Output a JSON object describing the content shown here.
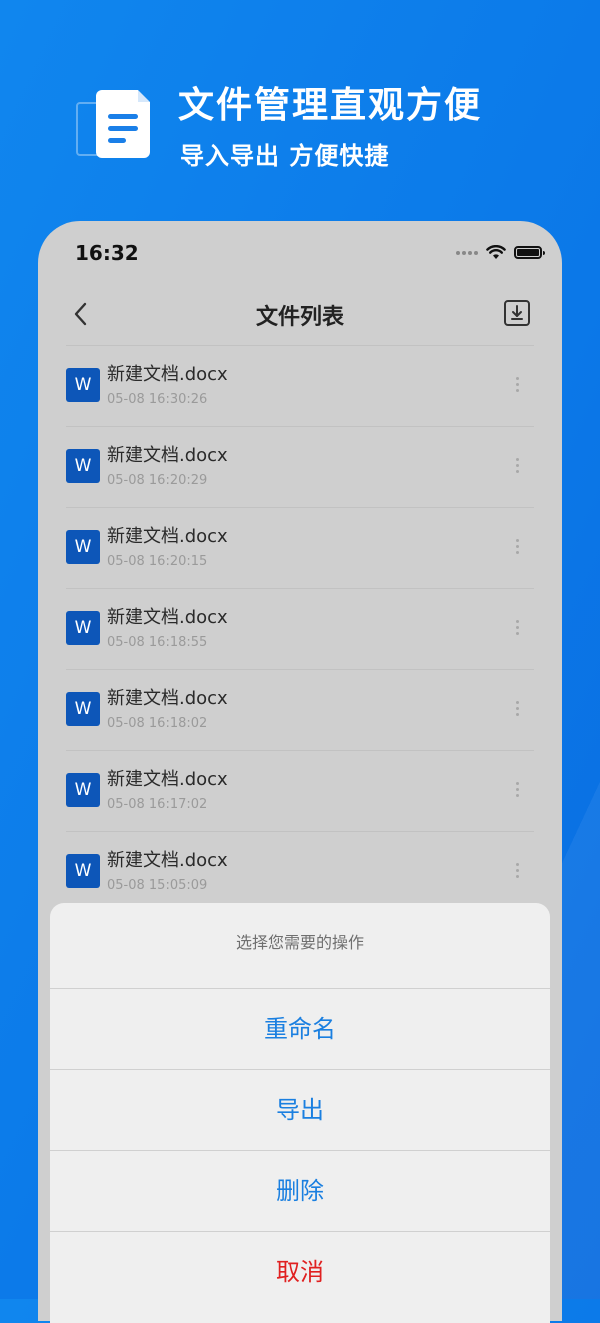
{
  "promo": {
    "title": "文件管理直观方便",
    "subtitle": "导入导出 方便快捷",
    "icon": "document-icon"
  },
  "status_bar": {
    "time": "16:32"
  },
  "nav": {
    "title": "文件列表",
    "back_icon": "chevron-left-icon",
    "action_icon": "download-tray-icon"
  },
  "files": [
    {
      "icon_letter": "W",
      "name": "新建文档.docx",
      "time": "05-08 16:30:26"
    },
    {
      "icon_letter": "W",
      "name": "新建文档.docx",
      "time": "05-08 16:20:29"
    },
    {
      "icon_letter": "W",
      "name": "新建文档.docx",
      "time": "05-08 16:20:15"
    },
    {
      "icon_letter": "W",
      "name": "新建文档.docx",
      "time": "05-08 16:18:55"
    },
    {
      "icon_letter": "W",
      "name": "新建文档.docx",
      "time": "05-08 16:18:02"
    },
    {
      "icon_letter": "W",
      "name": "新建文档.docx",
      "time": "05-08 16:17:02"
    },
    {
      "icon_letter": "W",
      "name": "新建文档.docx",
      "time": "05-08 15:05:09"
    }
  ],
  "action_sheet": {
    "prompt": "选择您需要的操作",
    "rename": "重命名",
    "export": "导出",
    "delete": "删除",
    "cancel": "取消"
  },
  "colors": {
    "brand_blue": "#0b78e8",
    "action_blue": "#1a7fe0",
    "cancel_red": "#e02020",
    "word_icon": "#0d56b8"
  }
}
